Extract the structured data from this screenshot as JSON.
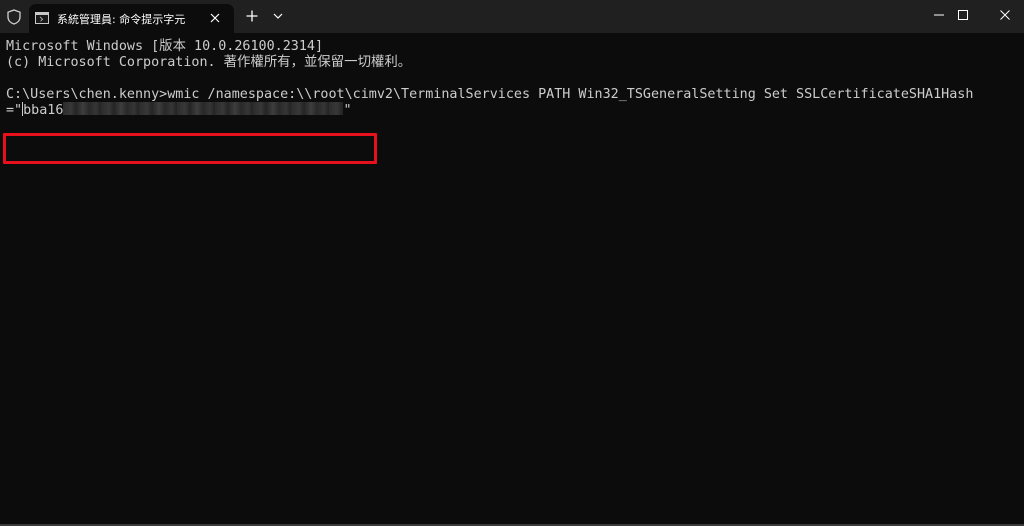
{
  "titlebar": {
    "tab_title": "系統管理員: 命令提示字元",
    "new_tab_label": "+",
    "icons": {
      "shield": "shield-icon",
      "tab": "terminal-icon",
      "close_tab": "close-icon",
      "dropdown": "chevron-down-icon",
      "minimize": "minimize-icon",
      "maximize": "maximize-icon",
      "close_window": "close-icon"
    }
  },
  "console": {
    "lines": [
      "Microsoft Windows [版本 10.0.26100.2314]",
      "(c) Microsoft Corporation. 著作權所有，並保留一切權利。",
      "C:\\Users\\chen.kenny>wmic /namespace:\\\\root\\cimv2\\TerminalServices PATH Win32_TSGeneralSetting Set SSLCertificateSHA1Hash"
    ],
    "hash_prefix": "=\"",
    "hash_visible": "bba16",
    "hash_suffix": "\""
  },
  "colors": {
    "background": "#0c0c0c",
    "titlebar": "#202020",
    "text": "#cccccc",
    "highlight": "#e8101c"
  }
}
